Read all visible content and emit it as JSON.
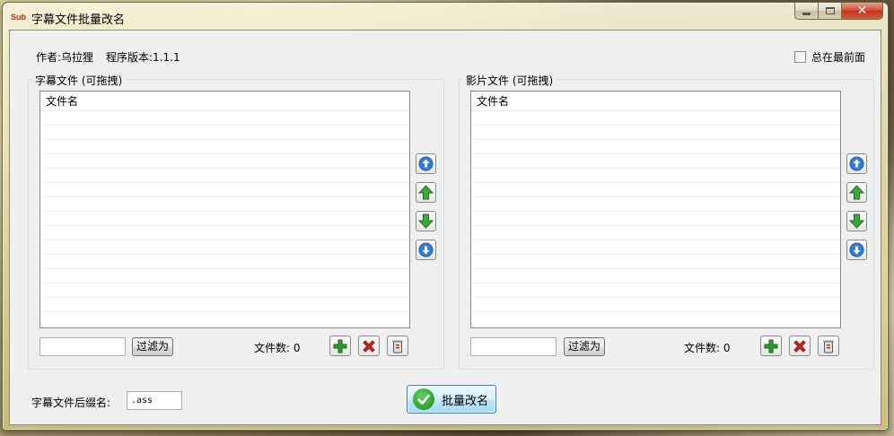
{
  "window": {
    "icon_text": "Sub",
    "title": "字幕文件批量改名",
    "close_glyph": "✕"
  },
  "info": {
    "author": "作者:乌拉狸",
    "version": "程序版本:1.1.1",
    "always_on_top_label": "总在最前面",
    "always_on_top_checked": false
  },
  "subtitle_panel": {
    "title": "字幕文件 (可拖拽)",
    "column_header": "文件名",
    "filter_value": "",
    "filter_button": "过滤为",
    "count_label": "文件数: 0"
  },
  "video_panel": {
    "title": "影片文件 (可拖拽)",
    "column_header": "文件名",
    "filter_value": "",
    "filter_button": "过滤为",
    "count_label": "文件数: 0"
  },
  "bottom": {
    "ext_label": "字幕文件后缀名:",
    "ext_value": ".ass",
    "rename_button": "批量改名"
  },
  "icons": {
    "move_top": "move-top-icon",
    "move_up": "move-up-icon",
    "move_down": "move-down-icon",
    "move_bottom": "move-bottom-icon",
    "add": "add-icon",
    "remove": "remove-icon",
    "clear": "clear-icon",
    "confirm": "checkmark-icon"
  },
  "colors": {
    "accent_blue": "#3c7fb1",
    "add_green": "#2e9a2e",
    "remove_red": "#d12a1a"
  }
}
